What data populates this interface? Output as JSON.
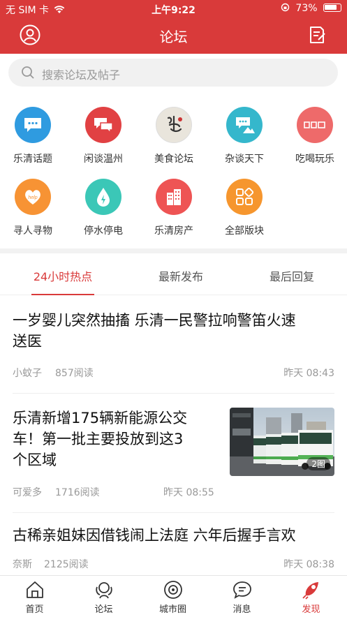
{
  "status_bar": {
    "carrier": "无 SIM 卡",
    "time": "上午9:22",
    "battery": "73%"
  },
  "header": {
    "title": "论坛",
    "left_icon": "user-icon",
    "right_icon": "edit-icon"
  },
  "search": {
    "placeholder": "搜索论坛及帖子"
  },
  "categories": [
    {
      "label": "乐清话题",
      "icon": "chat-bubble-icon",
      "color": "#2f9be0"
    },
    {
      "label": "闲谈温州",
      "icon": "chat-bubbles-icon",
      "color": "#e14143"
    },
    {
      "label": "美食论坛",
      "icon": "food-calligraphy-icon",
      "color": "#e9e5dc"
    },
    {
      "label": "杂谈天下",
      "icon": "chat-mountain-icon",
      "color": "#35b7cc"
    },
    {
      "label": "吃喝玩乐",
      "icon": "fun-text-icon",
      "color": "#ee6a6a"
    },
    {
      "label": "寻人寻物",
      "icon": "heart-help-icon",
      "color": "#f79334"
    },
    {
      "label": "停水停电",
      "icon": "water-power-icon",
      "color": "#3bc7b7"
    },
    {
      "label": "乐清房产",
      "icon": "building-icon",
      "color": "#ee5454"
    },
    {
      "label": "全部版块",
      "icon": "grid-icon",
      "color": "#f6962e"
    }
  ],
  "tabs": [
    {
      "label": "24小时热点"
    },
    {
      "label": "最新发布"
    },
    {
      "label": "最后回复"
    }
  ],
  "posts": [
    {
      "title_line1": "一岁婴儿突然抽搐 乐清一民警拉响警笛火速",
      "title_line2": "送医",
      "author": "小蚊子",
      "reads": "857阅读",
      "time": "昨天 08:43"
    },
    {
      "title_line1": "乐清新增175辆新能源公交",
      "title_line2": "车！第一批主要投放到这3",
      "title_line3": "个区域",
      "author": "可爱多",
      "reads": "1716阅读",
      "time": "昨天 08:55",
      "image_count": "2图"
    },
    {
      "title_line1": "古稀亲姐妹因借钱闹上法庭 六年后握手言欢",
      "author": "奈斯",
      "reads": "2125阅读",
      "time": "昨天 08:38"
    }
  ],
  "bottom_nav": [
    {
      "label": "首页",
      "icon": "home-icon"
    },
    {
      "label": "论坛",
      "icon": "forum-icon"
    },
    {
      "label": "城市圈",
      "icon": "city-circle-icon"
    },
    {
      "label": "消息",
      "icon": "message-icon"
    },
    {
      "label": "发现",
      "icon": "discover-icon"
    }
  ],
  "colors": {
    "accent": "#d93a3a"
  }
}
